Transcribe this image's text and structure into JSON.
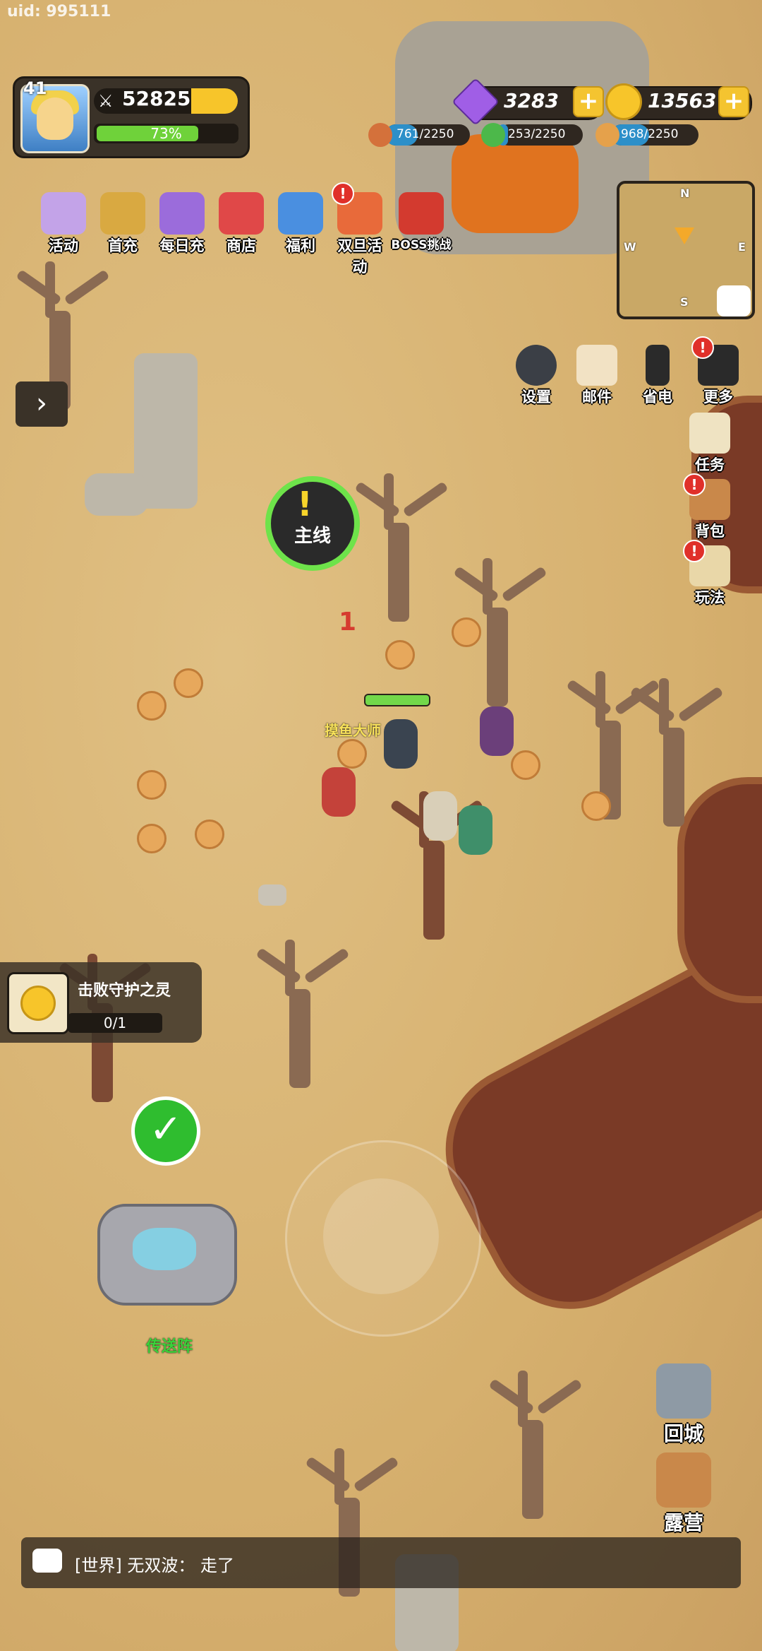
{
  "uid": "uid: 995111",
  "player": {
    "level": "41",
    "power": "52825",
    "exp_percent": "73%",
    "exp_fraction": 0.73
  },
  "currency": {
    "gems": "3283",
    "gold": "13563"
  },
  "resources": [
    {
      "value": "761/2250",
      "color": "#d4713b",
      "icon": "meat-icon"
    },
    {
      "value": "253/2250",
      "color": "#4cb84a",
      "icon": "herb-icon"
    },
    {
      "value": "968/2250",
      "color": "#e5a14b",
      "icon": "wood-icon"
    }
  ],
  "top_menu": [
    {
      "label": "活动",
      "icon": "activity-chest-icon",
      "color": "#c3a3e8",
      "badge": false
    },
    {
      "label": "首充",
      "icon": "first-recharge-icon",
      "color": "#d9a941",
      "badge": false
    },
    {
      "label": "每日充",
      "icon": "daily-recharge-icon",
      "color": "#9b6cdb",
      "badge": false
    },
    {
      "label": "商店",
      "icon": "shop-icon",
      "color": "#e04848",
      "badge": false
    },
    {
      "label": "福利",
      "icon": "gift-icon",
      "color": "#4a8fe0",
      "badge": false
    },
    {
      "label": "双旦活动",
      "icon": "holiday-event-icon",
      "color": "#e86a3a",
      "badge": true
    },
    {
      "label": "BOSS挑战",
      "icon": "boss-challenge-icon",
      "color": "#d33a2f",
      "badge": false
    }
  ],
  "minimap": {
    "n": "N",
    "s": "S",
    "w": "W",
    "e": "E"
  },
  "settings_row": [
    {
      "label": "设置",
      "icon": "gear-icon",
      "badge": false
    },
    {
      "label": "邮件",
      "icon": "mail-icon",
      "badge": false
    },
    {
      "label": "省电",
      "icon": "battery-icon",
      "badge": false
    },
    {
      "label": "更多",
      "icon": "more-grid-icon",
      "badge": true
    }
  ],
  "side_menu": [
    {
      "label": "任务",
      "icon": "scroll-icon",
      "badge": false
    },
    {
      "label": "背包",
      "icon": "backpack-icon",
      "badge": true
    },
    {
      "label": "玩法",
      "icon": "gameplay-sword-icon",
      "badge": true
    }
  ],
  "badge_text": "!",
  "quest_marker": {
    "label": "主线",
    "mark": "!"
  },
  "damage_number": "1",
  "npc_name": "摸鱼大师",
  "task": {
    "title": "击败守护之灵",
    "progress": "0/1"
  },
  "portal_label": "传送阵",
  "right_buttons": [
    {
      "label": "回城",
      "icon": "return-city-icon"
    },
    {
      "label": "露营",
      "icon": "camp-tent-icon"
    }
  ],
  "chat": {
    "text": "[世界] 无双波： 走了"
  }
}
